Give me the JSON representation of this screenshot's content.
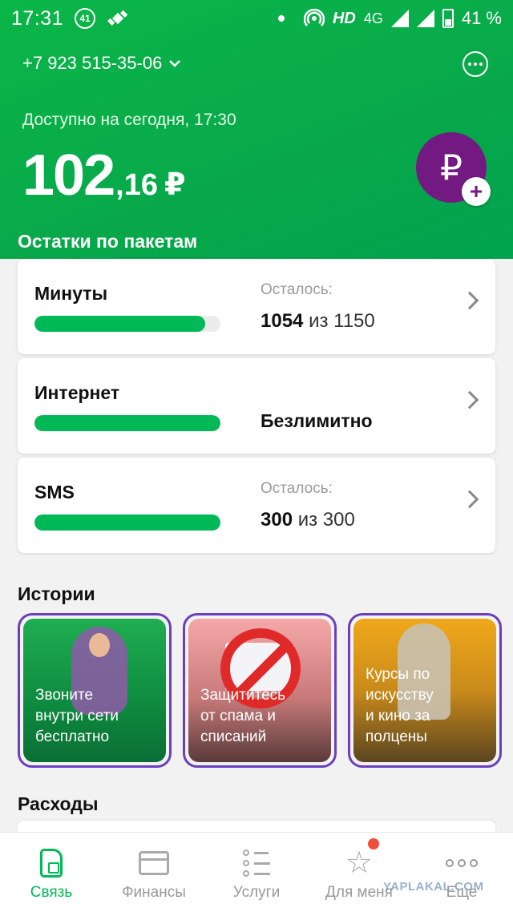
{
  "status_bar": {
    "time": "17:31",
    "badge": "41",
    "network_hd": "HD",
    "network_type": "4G",
    "battery": "41 %"
  },
  "header": {
    "phone": "+7 923 515-35-06",
    "available_label": "Доступно на сегодня, 17:30",
    "balance_int": "102",
    "balance_frac": ",16",
    "currency": "₽",
    "ruble_symbol": "₽",
    "plus_symbol": "+"
  },
  "packages": {
    "title": "Остатки по пакетам",
    "items": [
      {
        "name": "Минуты",
        "rest_label": "Осталось:",
        "used": "1054",
        "of": "из 1150",
        "fill": 0.917
      },
      {
        "name": "Интернет",
        "value": "Безлимитно",
        "fill": 1.0
      },
      {
        "name": "SMS",
        "rest_label": "Осталось:",
        "used": "300",
        "of": "из 300",
        "fill": 1.0
      }
    ]
  },
  "stories": {
    "title": "Истории",
    "items": [
      {
        "text": "Звоните\nвнутри сети\nбесплатно"
      },
      {
        "text": "Защититесь\nот спама и\nсписаний"
      },
      {
        "text": "Курсы по\nискусству\nи кино за\nполцены"
      }
    ]
  },
  "spending": {
    "title": "Расходы"
  },
  "tabbar": {
    "tabs": [
      {
        "label": "Связь",
        "icon": "sim-icon",
        "active": true
      },
      {
        "label": "Финансы",
        "icon": "card-icon",
        "active": false
      },
      {
        "label": "Услуги",
        "icon": "list-icon",
        "active": false
      },
      {
        "label": "Для меня",
        "icon": "star-icon",
        "active": false
      },
      {
        "label": "Еще",
        "icon": "more-icon",
        "active": false
      }
    ]
  },
  "watermark": "YAPLAKAL.COM",
  "colors": {
    "accent_green": "#00b956",
    "brand_purple": "#731982",
    "notif_red": "#f04e3a"
  }
}
